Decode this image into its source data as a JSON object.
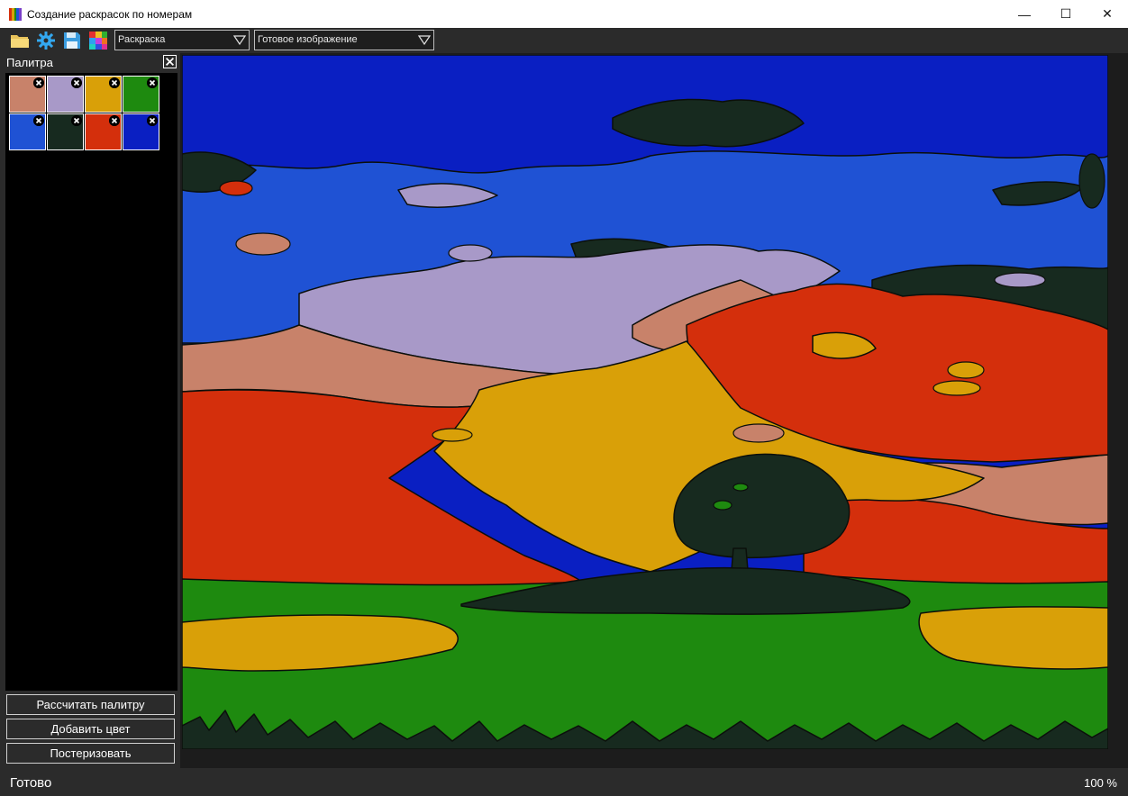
{
  "window": {
    "title": "Создание раскрасок по номерам",
    "minimize_glyph": "—",
    "maximize_glyph": "☐",
    "close_glyph": "✕"
  },
  "toolbar": {
    "icons": [
      "folder-open-icon",
      "settings-gear-icon",
      "save-disk-icon",
      "palette-grid-icon"
    ],
    "mode_select": {
      "value": "Раскраска"
    },
    "view_select": {
      "value": "Готовое изображение"
    }
  },
  "palette_panel": {
    "title": "Палитра",
    "swatches": [
      {
        "color": "#c8826a"
      },
      {
        "color": "#a899c8"
      },
      {
        "color": "#d9a008"
      },
      {
        "color": "#1e8a0f"
      },
      {
        "color": "#1f52d4"
      },
      {
        "color": "#172a1f"
      },
      {
        "color": "#d42f0c"
      },
      {
        "color": "#0a1fc2"
      }
    ],
    "buttons": {
      "calculate_palette": "Рассчитать палитру",
      "add_color": "Добавить цвет",
      "posterize": "Постеризовать"
    }
  },
  "status": {
    "text": "Готово",
    "zoom": "100 %"
  },
  "colors": {
    "sky_deep": "#0a1fc2",
    "sky_light": "#1f52d4",
    "lavender": "#a899c8",
    "salmon": "#c8826a",
    "red": "#d42f0c",
    "gold": "#d9a008",
    "green": "#1e8a0f",
    "dark": "#172a1f"
  }
}
